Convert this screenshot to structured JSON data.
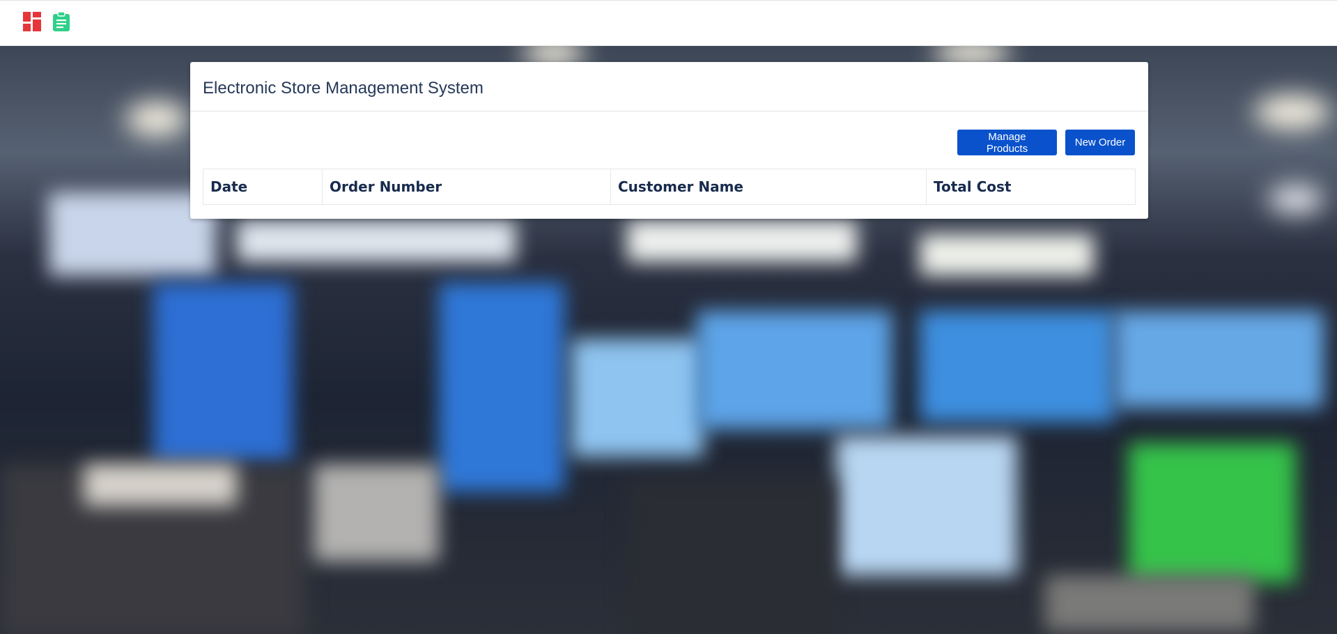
{
  "navbar": {
    "icons": [
      {
        "name": "dashboard-icon",
        "color": "#e5353b"
      },
      {
        "name": "clipboard-icon",
        "color": "#2fd08a"
      }
    ]
  },
  "card": {
    "title": "Electronic Store Management System",
    "buttons": {
      "manage_products": "Manage Products",
      "new_order": "New Order"
    },
    "button_color": "#0a52cc",
    "table": {
      "columns": [
        "Date",
        "Order Number",
        "Customer Name",
        "Total Cost"
      ],
      "rows": []
    }
  }
}
